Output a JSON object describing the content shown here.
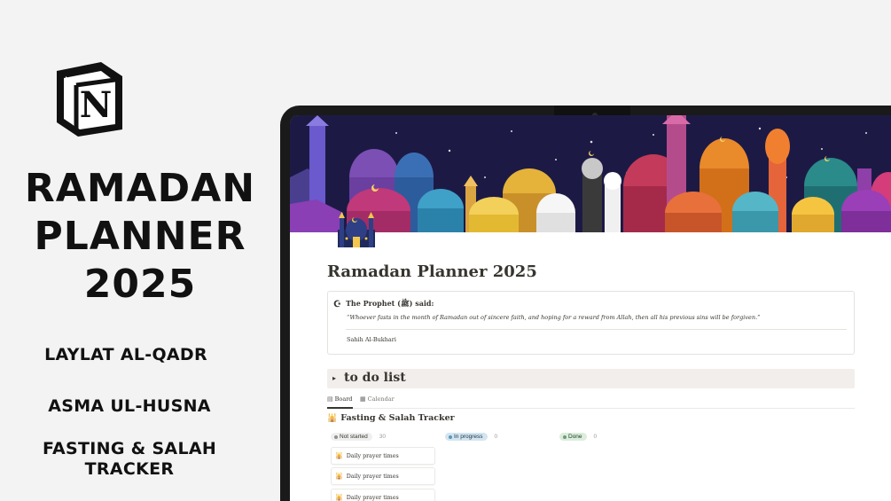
{
  "promo": {
    "title_lines": [
      "RAMADAN",
      "PLANNER",
      "2025"
    ],
    "features": [
      "LAYLAT AL-QADR",
      "ASMA UL-HUSNA",
      "FASTING & SALAH",
      "TRACKER"
    ]
  },
  "page": {
    "title": "Ramadan Planner 2025",
    "quote": {
      "icon": "crescent-moon-icon",
      "heading": "The Prophet (ﷺ) said:",
      "text": "“Whoever fasts in the month of Ramadan out of sincere faith, and hoping for a reward from Allah, then all his previous sins will be forgiven.”",
      "source": "Sahih Al-Bukhari"
    },
    "todo": {
      "label": "to do list"
    },
    "tabs": [
      {
        "label": "Board",
        "icon": "board-icon",
        "active": true
      },
      {
        "label": "Calendar",
        "icon": "calendar-icon",
        "active": false
      }
    ],
    "database": {
      "title": "Fasting & Salah Tracker",
      "groups": [
        {
          "label": "Not started",
          "count": "30",
          "bg": "#efefee",
          "dot": "#91918e",
          "color": "#37352f"
        },
        {
          "label": "In progress",
          "count": "0",
          "bg": "#d3e5ef",
          "dot": "#5b97bd",
          "color": "#183347"
        },
        {
          "label": "Done",
          "count": "0",
          "bg": "#dbeddb",
          "dot": "#6c9b7d",
          "color": "#1c3829"
        }
      ],
      "cards": [
        "Daily prayer times",
        "Daily prayer times",
        "Daily prayer times"
      ]
    }
  },
  "colors": {
    "background": "#f3f3f3",
    "laptop_bezel": "#1a1a1a",
    "cover_sky": "#1c1a45",
    "text": "#37352f"
  }
}
